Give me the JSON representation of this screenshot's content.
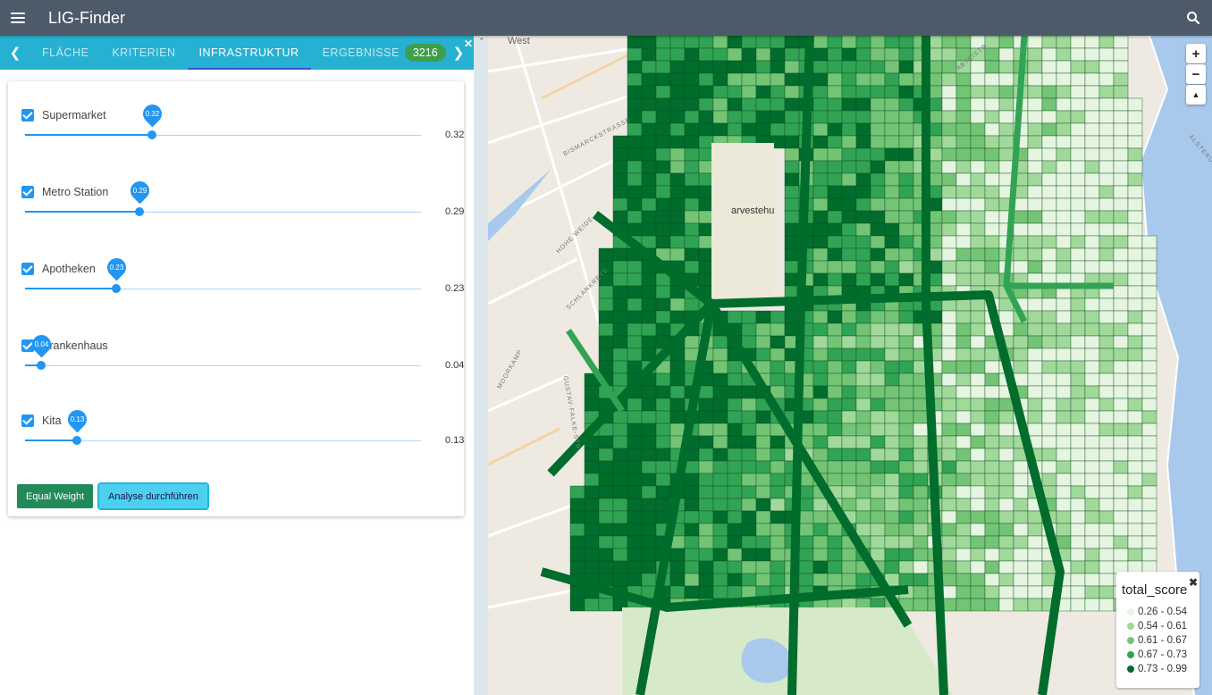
{
  "app": {
    "title": "LIG-Finder"
  },
  "tabs": [
    {
      "label": "FLÄCHE"
    },
    {
      "label": "KRITERIEN"
    },
    {
      "label": "INFRASTRUKTUR"
    },
    {
      "label": "ERGEBNISSE"
    }
  ],
  "results_count": "3216",
  "active_tab": "INFRASTRUKTUR",
  "criteria": [
    {
      "label": "Supermarket",
      "value": "0.32",
      "weight": 0.32,
      "checked": true
    },
    {
      "label": "Metro Station",
      "value": "0.29",
      "weight": 0.29,
      "checked": true
    },
    {
      "label": "Apotheken",
      "value": "0.23",
      "weight": 0.23,
      "checked": true
    },
    {
      "label": "Krankenhaus",
      "value": "0.04",
      "weight": 0.04,
      "checked": true
    },
    {
      "label": "Kita",
      "value": "0.13",
      "weight": 0.13,
      "checked": true
    }
  ],
  "buttons": {
    "equal_weight": "Equal Weight",
    "analyse": "Analyse durchführen"
  },
  "map": {
    "zoom_in": "+",
    "zoom_out": "−",
    "compass": "▲",
    "place_labels": {
      "west": "West",
      "bismarck": "BISMARCKSTRASSE",
      "hohe_weide": "HOHE WEIDE",
      "schlankreye": "SCHLANKREYE",
      "gustav": "GUSTAV-FALKE-STR.",
      "harvestehude": "arvestehu",
      "abteistrasse": "ABTEISTR.",
      "alster": "ALSTERUFER",
      "moorkamp": "MOORKAMP"
    },
    "legend": {
      "title": "total_score",
      "items": [
        {
          "label": "0.26 - 0.54",
          "color": "#e5f5e0"
        },
        {
          "label": "0.54 - 0.61",
          "color": "#a1d99b"
        },
        {
          "label": "0.61 - 0.67",
          "color": "#74c476"
        },
        {
          "label": "0.67 - 0.73",
          "color": "#31a354"
        },
        {
          "label": "0.73 - 0.99",
          "color": "#006d2c"
        }
      ]
    }
  },
  "colors": {
    "appbar": "#4d5a6a",
    "tabbar": "#26b1d2",
    "accent": "#2196f3",
    "badge": "#3d9e4c",
    "water": "#a9c9ec"
  }
}
